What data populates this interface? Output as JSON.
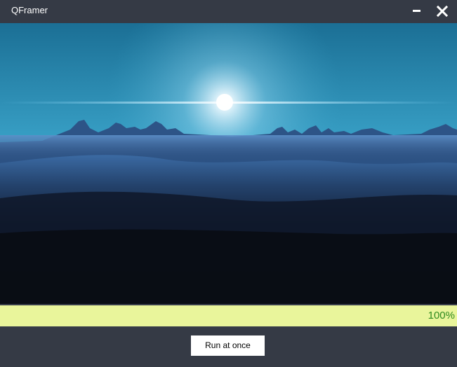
{
  "window": {
    "title": "QFramer"
  },
  "icons": {
    "minimize": "minimize-icon",
    "close": "close-icon"
  },
  "progress": {
    "value": 1.0,
    "label": "100%",
    "fill_color": "#e9f59b",
    "text_color": "#2f8a1f"
  },
  "actions": {
    "run_label": "Run at once"
  },
  "colors": {
    "chrome": "#353a45",
    "button_bg": "#ffffff"
  }
}
